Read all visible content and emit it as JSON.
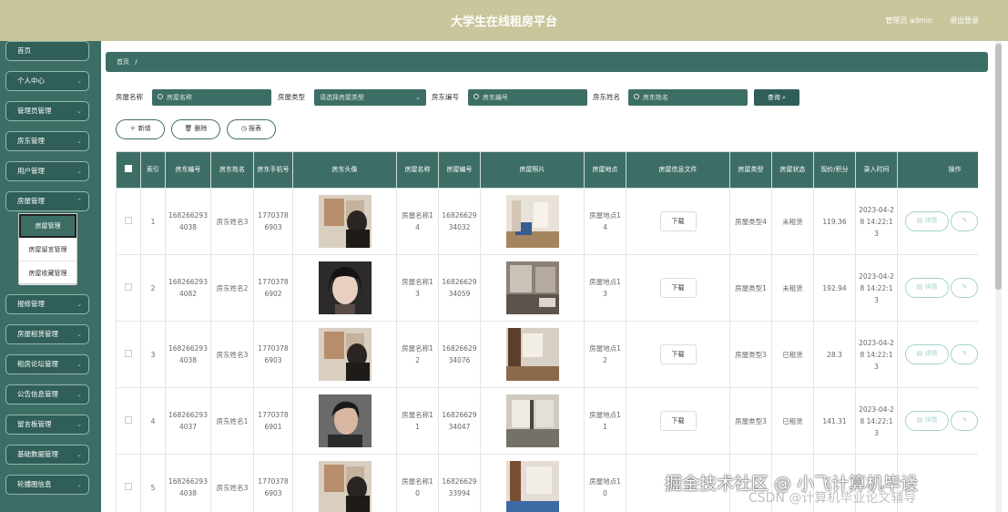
{
  "header": {
    "title": "大学生在线租房平台",
    "admin": "管理员 admin",
    "logout": "退出登录"
  },
  "colors": {
    "header": "#c9c69c",
    "accent": "#3d6e66"
  },
  "sidebar": {
    "items": [
      {
        "label": "首页",
        "chevron": ""
      },
      {
        "label": "个人中心",
        "chevron": "⌄"
      },
      {
        "label": "管理员管理",
        "chevron": "⌄"
      },
      {
        "label": "房东管理",
        "chevron": "⌄"
      },
      {
        "label": "用户管理",
        "chevron": "⌄"
      },
      {
        "label": "房屋管理",
        "chevron": "⌃"
      },
      {
        "label": "报修管理",
        "chevron": "⌄"
      },
      {
        "label": "房屋租赁管理",
        "chevron": "⌄"
      },
      {
        "label": "租房论坛管理",
        "chevron": "⌄"
      },
      {
        "label": "公告信息管理",
        "chevron": "⌄"
      },
      {
        "label": "留言板管理",
        "chevron": "⌄"
      },
      {
        "label": "基础数据管理",
        "chevron": "⌄"
      },
      {
        "label": "轮播图信息",
        "chevron": "⌄"
      }
    ],
    "submenu": [
      "房屋管理",
      "房屋留言管理",
      "房屋收藏管理"
    ]
  },
  "breadcrumb": {
    "home": "首页",
    "sep": "/"
  },
  "search": {
    "name_label": "房屋名称",
    "name_placeholder": "房屋名称",
    "type_label": "房屋类型",
    "type_placeholder": "请选择房屋类型",
    "code_label": "房东编号",
    "code_placeholder": "房东编号",
    "owner_label": "房东姓名",
    "owner_placeholder": "房东姓名",
    "query_button": "查询"
  },
  "actions": {
    "add": "新增",
    "delete": "删除",
    "report": "报表"
  },
  "table": {
    "headers": [
      "",
      "索引",
      "房东编号",
      "房东姓名",
      "房东手机号",
      "房东头像",
      "房屋名称",
      "房屋编号",
      "房屋照片",
      "房屋地点",
      "房屋信息文件",
      "房屋类型",
      "房屋状态",
      "现价/积分",
      "录入时间",
      "操作"
    ],
    "download_label": "下载",
    "detail_label": "详情",
    "rows": [
      {
        "index": "1",
        "owner_code": "1682662934038",
        "owner_name": "房东姓名3",
        "owner_phone": "17703786903",
        "house_name": "房屋名称14",
        "house_code": "1682662934032",
        "location": "房屋地点14",
        "type": "房屋类型4",
        "status": "未租赁",
        "price": "119.36",
        "time": "2023-04-28 14:22:13"
      },
      {
        "index": "2",
        "owner_code": "1682662934082",
        "owner_name": "房东姓名2",
        "owner_phone": "17703786902",
        "house_name": "房屋名称13",
        "house_code": "1682662934059",
        "location": "房屋地点13",
        "type": "房屋类型1",
        "status": "未租赁",
        "price": "192.94",
        "time": "2023-04-28 14:22:13"
      },
      {
        "index": "3",
        "owner_code": "1682662934038",
        "owner_name": "房东姓名3",
        "owner_phone": "17703786903",
        "house_name": "房屋名称12",
        "house_code": "1682662934076",
        "location": "房屋地点12",
        "type": "房屋类型3",
        "status": "已租赁",
        "price": "28.3",
        "time": "2023-04-28 14:22:13"
      },
      {
        "index": "4",
        "owner_code": "1682662934037",
        "owner_name": "房东姓名1",
        "owner_phone": "17703786901",
        "house_name": "房屋名称11",
        "house_code": "1682662934047",
        "location": "房屋地点11",
        "type": "房屋类型3",
        "status": "已租赁",
        "price": "141.31",
        "time": "2023-04-28 14:22:13"
      },
      {
        "index": "5",
        "owner_code": "1682662934038",
        "owner_name": "房东姓名3",
        "owner_phone": "17703786903",
        "house_name": "房屋名称10",
        "house_code": "1682662933994",
        "location": "房屋地点10",
        "type": "",
        "status": "",
        "price": "",
        "time": ""
      }
    ]
  },
  "watermark": {
    "main": "掘金技术社区 @ 小飞计算机毕设",
    "secondary": "CSDN @计算机毕业论文辅导"
  }
}
